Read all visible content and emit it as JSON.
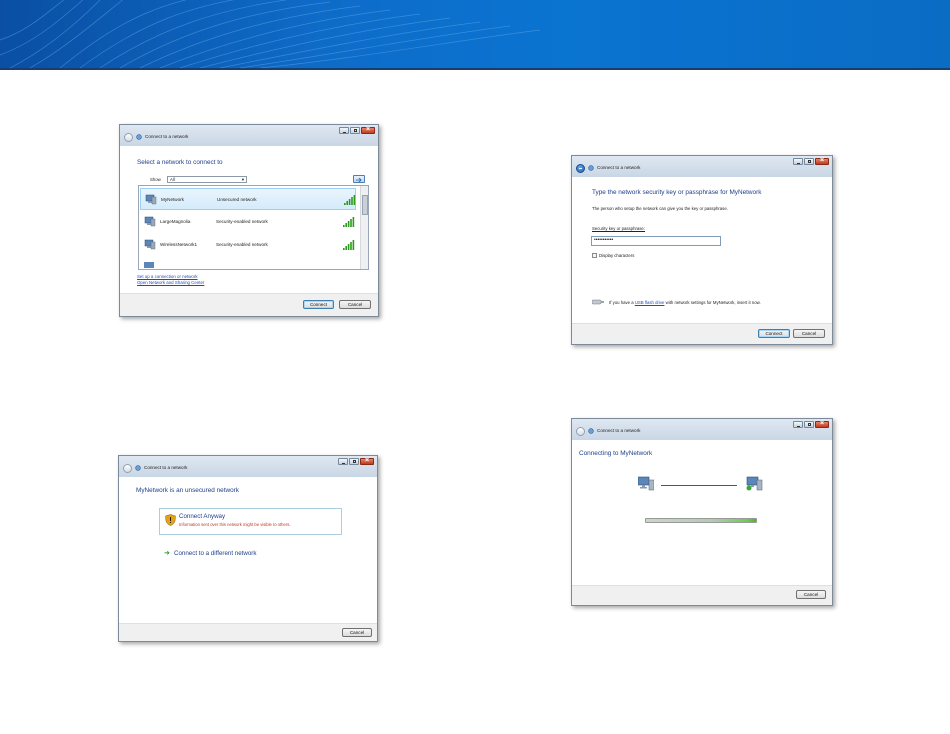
{
  "colors": {
    "banner": "#0a6cc9",
    "heading": "#1e3f8a",
    "link": "#2349b8"
  },
  "dialog_select": {
    "window_title": "Connect to a network",
    "heading": "Select a network to connect to",
    "show_label": "Show",
    "show_value": "All",
    "networks": [
      {
        "name": "MyNetwork",
        "security": "Unsecured network",
        "selected": true
      },
      {
        "name": "LargeMagnolia",
        "security": "Security-enabled network",
        "selected": false
      },
      {
        "name": "WirelessNetwork1",
        "security": "Security-enabled network",
        "selected": false
      }
    ],
    "link_setup": "Set up a connection or network",
    "link_center": "Open Network and Sharing Center",
    "connect_label": "Connect",
    "cancel_label": "Cancel"
  },
  "dialog_key": {
    "window_title": "Connect to a network",
    "heading": "Type the network security key or passphrase for MyNetwork",
    "subtext": "The person who setup the network can give you the key or passphrase.",
    "field_label": "Security key or passphrase:",
    "field_value": "•••••••••••",
    "display_label": "Display characters",
    "usb_text_before": "If you have a ",
    "usb_link": "USB flash drive",
    "usb_text_after": " with network settings for MyNetwork, insert it now.",
    "connect_label": "Connect",
    "cancel_label": "Cancel"
  },
  "dialog_unsecured": {
    "window_title": "Connect to a network",
    "heading": "MyNetwork is an unsecured network",
    "option_title": "Connect Anyway",
    "option_desc": "Information sent over this network might be visible to others.",
    "alt_option": "Connect to a different network",
    "cancel_label": "Cancel"
  },
  "dialog_connecting": {
    "window_title": "Connect to a network",
    "heading": "Connecting to MyNetwork",
    "progress": 1.0,
    "cancel_label": "Cancel"
  }
}
